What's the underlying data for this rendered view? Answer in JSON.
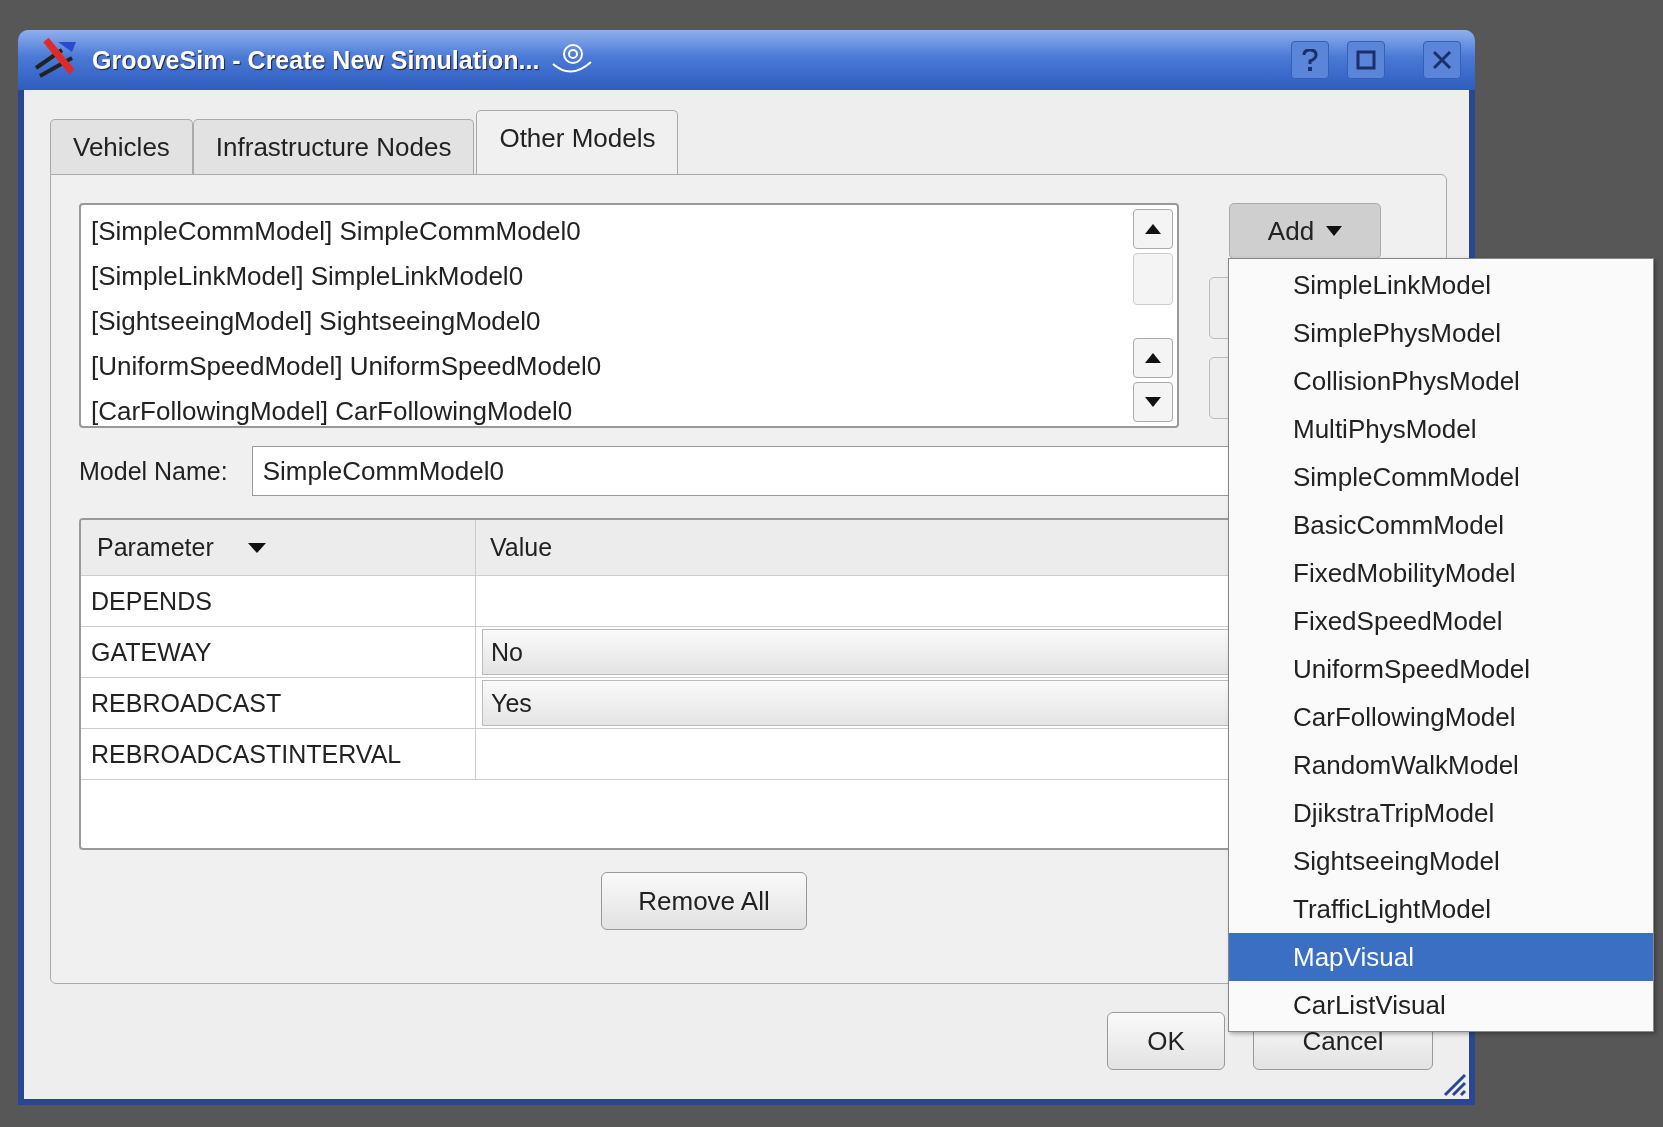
{
  "window": {
    "title": "GrooveSim - Create New Simulation..."
  },
  "tabs": [
    {
      "label": "Vehicles",
      "selected": false
    },
    {
      "label": "Infrastructure Nodes",
      "selected": false
    },
    {
      "label": "Other Models",
      "selected": true
    }
  ],
  "model_list": [
    "[SimpleCommModel] SimpleCommModel0",
    "[SimpleLinkModel] SimpleLinkModel0",
    "[SightseeingModel] SightseeingModel0",
    "[UniformSpeedModel] UniformSpeedModel0",
    "[CarFollowingModel] CarFollowingModel0"
  ],
  "add_button": {
    "label": "Add"
  },
  "add_menu": [
    {
      "label": "SimpleLinkModel",
      "selected": false
    },
    {
      "label": "SimplePhysModel",
      "selected": false
    },
    {
      "label": "CollisionPhysModel",
      "selected": false
    },
    {
      "label": "MultiPhysModel",
      "selected": false
    },
    {
      "label": "SimpleCommModel",
      "selected": false
    },
    {
      "label": "BasicCommModel",
      "selected": false
    },
    {
      "label": "FixedMobilityModel",
      "selected": false
    },
    {
      "label": "FixedSpeedModel",
      "selected": false
    },
    {
      "label": "UniformSpeedModel",
      "selected": false
    },
    {
      "label": "CarFollowingModel",
      "selected": false
    },
    {
      "label": "RandomWalkModel",
      "selected": false
    },
    {
      "label": "DjikstraTripModel",
      "selected": false
    },
    {
      "label": "SightseeingModel",
      "selected": false
    },
    {
      "label": "TrafficLightModel",
      "selected": false
    },
    {
      "label": "MapVisual",
      "selected": true
    },
    {
      "label": "CarListVisual",
      "selected": false
    }
  ],
  "model_name": {
    "label": "Model Name:",
    "value": "SimpleCommModel0"
  },
  "parameters": {
    "columns": [
      "Parameter",
      "Value"
    ],
    "rows": [
      {
        "name": "DEPENDS",
        "kind": "text"
      },
      {
        "name": "GATEWAY",
        "kind": "combo",
        "value": "No"
      },
      {
        "name": "REBROADCAST",
        "kind": "combo",
        "value": "Yes"
      },
      {
        "name": "REBROADCASTINTERVAL",
        "kind": "text"
      }
    ]
  },
  "remove_all_button": {
    "label": "Remove All"
  },
  "buttons": [
    "OK",
    "Cancel"
  ]
}
